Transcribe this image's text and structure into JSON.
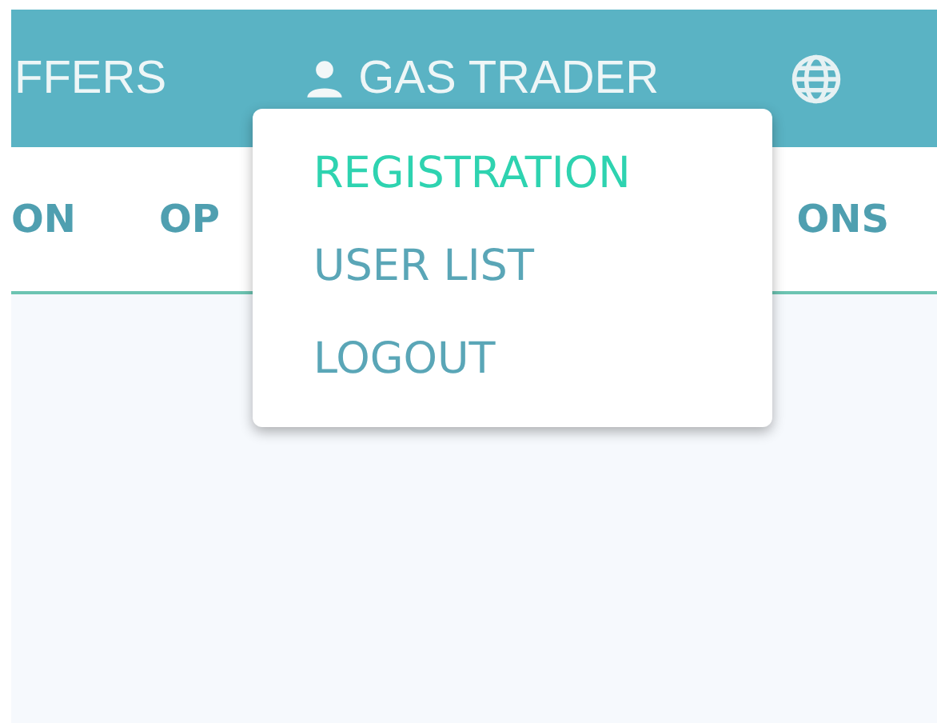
{
  "header": {
    "items": [
      {
        "kind": "link",
        "label": "FFERS"
      },
      {
        "kind": "user",
        "label": "GAS TRADER"
      },
      {
        "kind": "language"
      }
    ]
  },
  "tabs": [
    {
      "label": "ON"
    },
    {
      "label": "OP"
    },
    {
      "label": "ONS"
    }
  ],
  "user_menu": {
    "items": [
      {
        "label": "REGISTRATION",
        "selected": true
      },
      {
        "label": "USER LIST",
        "selected": false
      },
      {
        "label": "LOGOUT",
        "selected": false
      }
    ]
  }
}
